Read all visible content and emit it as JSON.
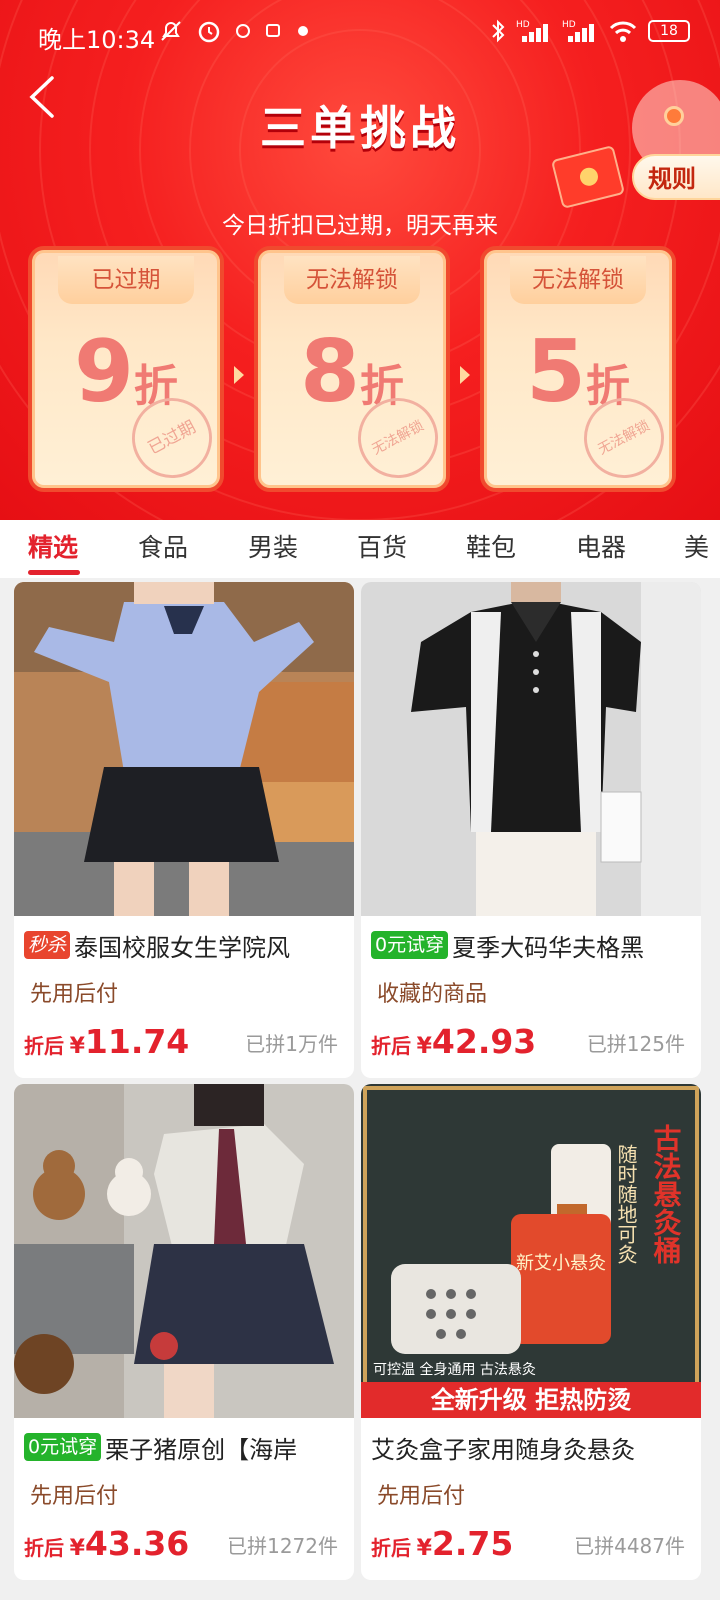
{
  "status": {
    "time": "晚上10:34",
    "battery": "18",
    "hd_labels": [
      "HD",
      "HD"
    ]
  },
  "header": {
    "title": "三单挑战",
    "subtitle": "今日折扣已过期，明天再来",
    "rules_label": "规则"
  },
  "discount_cards": [
    {
      "tag": "已过期",
      "value": "9",
      "unit": "折",
      "stamp": "已过期"
    },
    {
      "tag": "无法解锁",
      "value": "8",
      "unit": "折",
      "stamp": "无法解锁"
    },
    {
      "tag": "无法解锁",
      "value": "5",
      "unit": "折",
      "stamp": "无法解锁"
    }
  ],
  "tabs": [
    "精选",
    "食品",
    "男装",
    "百货",
    "鞋包",
    "电器",
    "美"
  ],
  "active_tab": "精选",
  "products": [
    {
      "badge": "秒杀",
      "badge_type": "flash",
      "title": "泰国校服女生学院风",
      "sub": "先用后付",
      "price_label": "折后",
      "currency": "¥",
      "price": "11.74",
      "sold": "已拼1万件"
    },
    {
      "badge": "0元试穿",
      "badge_type": "trial",
      "title": "夏季大码华夫格黑",
      "sub": "收藏的商品",
      "price_label": "折后",
      "currency": "¥",
      "price": "42.93",
      "sold": "已拼125件"
    },
    {
      "badge": "0元试穿",
      "badge_type": "trial",
      "title": "栗子猪原创【海岸",
      "sub": "先用后付",
      "price_label": "折后",
      "currency": "¥",
      "price": "43.36",
      "sold": "已拼1272件"
    },
    {
      "badge": "",
      "badge_type": "",
      "title": "艾灸盒子家用随身灸悬灸",
      "sub": "先用后付",
      "price_label": "折后",
      "currency": "¥",
      "price": "2.75",
      "sold": "已拼4487件"
    }
  ],
  "moxa_image_text": {
    "vertical": "古法悬灸桶",
    "side": "随时随地可灸",
    "can_label": "新艾小悬灸",
    "strip": "可控温 全身通用 古法悬灸",
    "banner": "全新升级 拒热防烫"
  },
  "colors": {
    "accent": "#e3222d",
    "header_red": "#f51f1f",
    "trial_green": "#24b32b"
  }
}
